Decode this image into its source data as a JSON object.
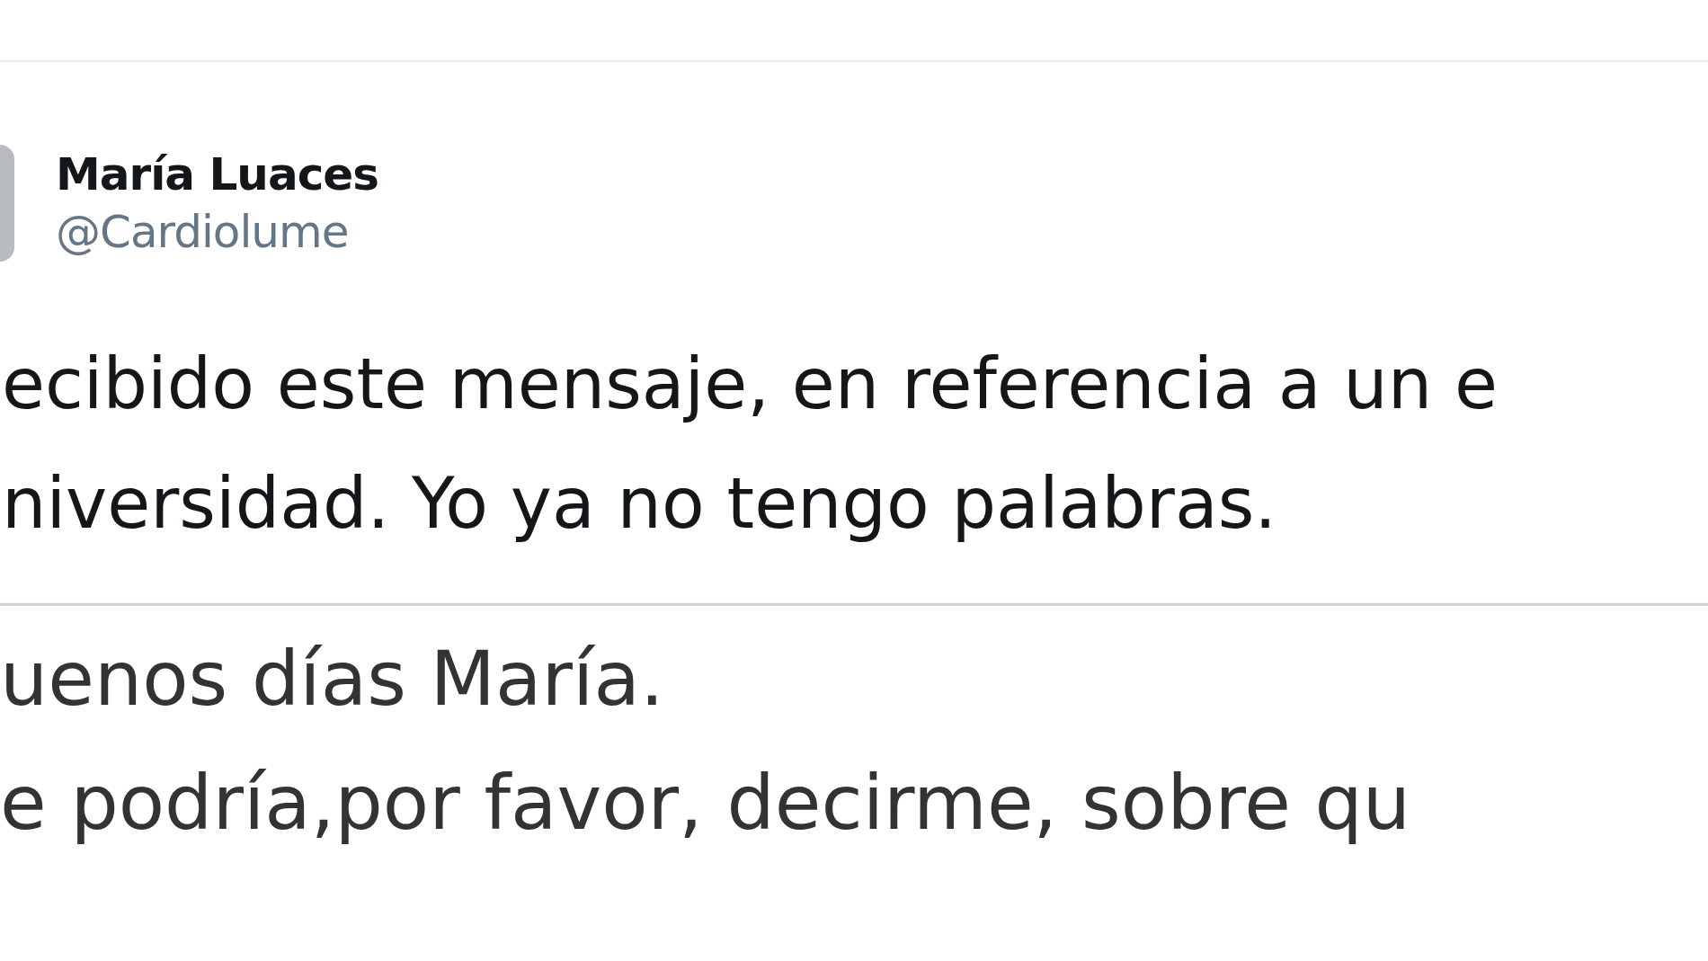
{
  "tweet": {
    "author": {
      "name": "María Luaces",
      "handle": "@Cardiolume"
    },
    "text_lines": [
      "ecibido este mensaje, en referencia a un e",
      "niversidad. Yo ya no tengo palabras."
    ]
  },
  "attached_image": {
    "text_lines": [
      "uenos días María.",
      "e podría,por favor, decirme, sobre qu"
    ]
  }
}
